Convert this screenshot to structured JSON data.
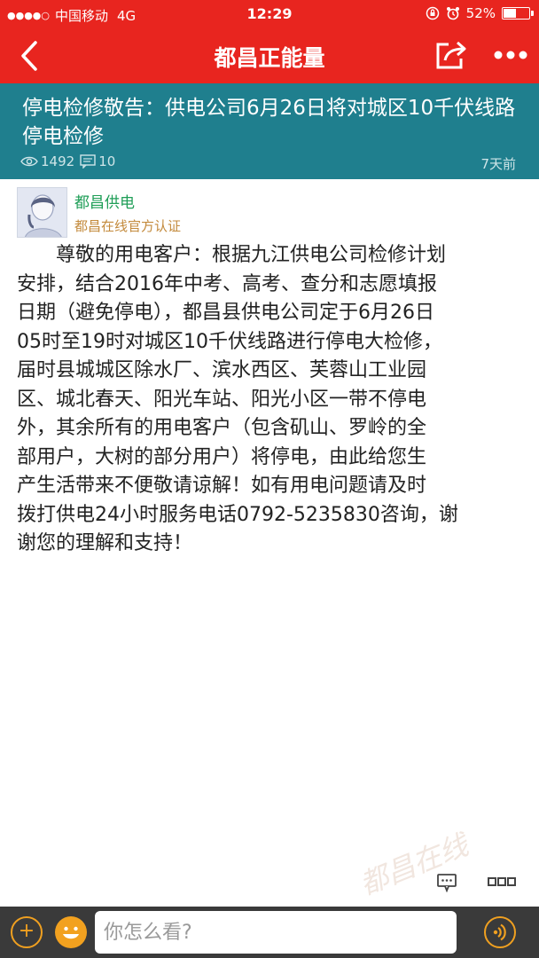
{
  "status_bar": {
    "signal_dots": "●●●●○",
    "carrier": "中国移动",
    "network": "4G",
    "time": "12:29",
    "battery_percent": "52%",
    "battery_level": 0.52
  },
  "nav": {
    "title": "都昌正能量"
  },
  "article": {
    "title": "停电检修敬告：供电公司6月26日将对城区10千伏线路停电检修",
    "views": "1492",
    "comments": "10",
    "age": "7天前"
  },
  "author": {
    "name": "都昌供电",
    "verification": "都昌在线官方认证"
  },
  "body_lines": [
    "尊敬的用电客户：根据九江供电公司检修计划",
    "安排，结合2016年中考、高考、查分和志愿填报",
    "日期（避免停电），都昌县供电公司定于6月26日",
    "05时至19时对城区10千伏线路进行停电大检修，",
    "届时县城城区除水厂、滨水西区、芙蓉山工业园",
    "区、城北春天、阳光车站、阳光小区一带不停电",
    "外，其余所有的用电客户（包含矶山、罗岭的全",
    "部用户，大树的部分用户）将停电，由此给您生",
    "产生活带来不便敬请谅解！如有用电问题请及时",
    "拨打供电24小时服务电话0792-5235830咨询，谢",
    "谢您的理解和支持！"
  ],
  "watermark": "都昌在线",
  "reply": {
    "placeholder": "你怎么看?",
    "plus_label": "+"
  },
  "colors": {
    "accent_red": "#e8251f",
    "header_teal": "#1f7f8e",
    "author_green": "#1f9e57",
    "verify_gold": "#c38a3c",
    "bottom_bar": "#3a3a3a",
    "button_orange": "#f0a020"
  },
  "icons": [
    "back-chevron-icon",
    "share-icon",
    "more-icon",
    "eye-icon",
    "comment-icon",
    "lock-rotation-icon",
    "alarm-icon",
    "battery-icon",
    "plus-icon",
    "emoji-icon",
    "voice-icon"
  ]
}
